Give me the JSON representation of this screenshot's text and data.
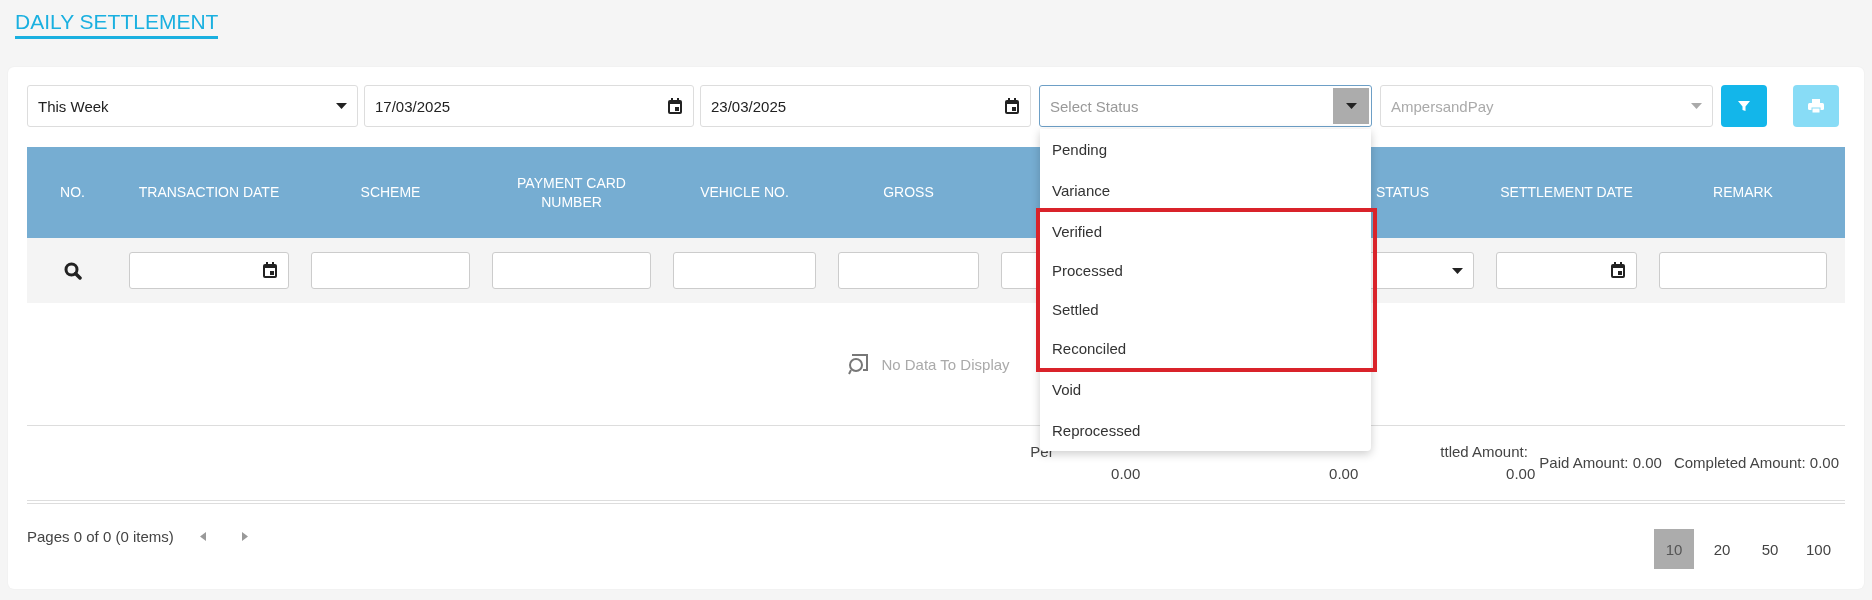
{
  "page_title": "DAILY SETTLEMENT",
  "filters": {
    "period": {
      "value": "This Week"
    },
    "start_date": {
      "value": "17/03/2025"
    },
    "end_date": {
      "value": "23/03/2025"
    },
    "status": {
      "placeholder": "Select Status",
      "expanded": true,
      "options": [
        {
          "label": "Pending",
          "highlighted": false
        },
        {
          "label": "Variance",
          "highlighted": false
        },
        {
          "label": "Verified",
          "highlighted": true
        },
        {
          "label": "Processed",
          "highlighted": true
        },
        {
          "label": "Settled",
          "highlighted": true
        },
        {
          "label": "Reconciled",
          "highlighted": true
        },
        {
          "label": "Void",
          "highlighted": false
        },
        {
          "label": "Reprocessed",
          "highlighted": false
        }
      ]
    },
    "provider": {
      "value": "AmpersandPay",
      "disabled": true
    },
    "filter_button": {
      "disabled": false
    },
    "print_button": {
      "disabled": true
    }
  },
  "table": {
    "columns": [
      {
        "label": "NO.",
        "kind": "search"
      },
      {
        "label": "TRANSACTION DATE",
        "kind": "date"
      },
      {
        "label": "SCHEME",
        "kind": "text"
      },
      {
        "label": "PAYMENT CARD NUMBER",
        "kind": "text"
      },
      {
        "label": "VEHICLE NO.",
        "kind": "text"
      },
      {
        "label": "GROSS",
        "kind": "text"
      },
      {
        "kind": "text"
      },
      {
        "kind": "hidden"
      },
      {
        "label": "STATUS",
        "kind": "select"
      },
      {
        "label": "SETTLEMENT DATE",
        "kind": "date"
      },
      {
        "label": "REMARK",
        "kind": "text"
      }
    ],
    "empty_message": "No Data To Display"
  },
  "summary": [
    {
      "label": "Per",
      "value": "0.00",
      "kind": "stacked"
    },
    {
      "value": "0.00",
      "kind": "stacked"
    },
    {
      "label": "ttled Amount:",
      "value": "0.00",
      "kind": "stacked"
    },
    {
      "label": "Paid Amount:",
      "value": "0.00",
      "kind": "inline"
    },
    {
      "label": "Completed Amount:",
      "value": "0.00",
      "kind": "inline"
    }
  ],
  "pager": {
    "info": "Pages 0 of 0 (0 items)",
    "page_sizes": [
      {
        "label": "10",
        "selected": true
      },
      {
        "label": "20",
        "selected": false
      },
      {
        "label": "50",
        "selected": false
      },
      {
        "label": "100",
        "selected": false
      }
    ]
  }
}
